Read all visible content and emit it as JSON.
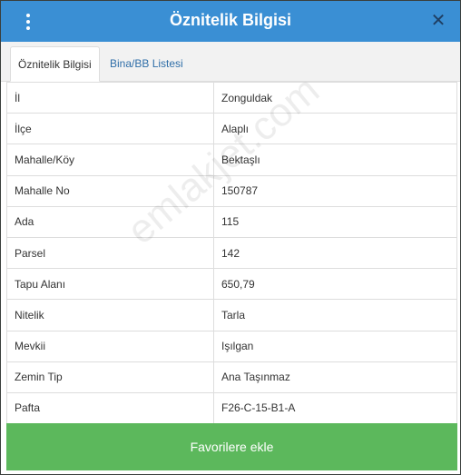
{
  "header": {
    "title": "Öznitelik Bilgisi",
    "menu_icon": "vertical-dots-icon",
    "close_icon": "close-icon",
    "close_glyph": "✕",
    "color": "#3a8fd4"
  },
  "tabs": [
    {
      "label": "Öznitelik Bilgisi",
      "active": true
    },
    {
      "label": "Bina/BB Listesi",
      "active": false
    }
  ],
  "attributes": [
    {
      "key": "İl",
      "value": "Zonguldak"
    },
    {
      "key": "İlçe",
      "value": "Alaplı"
    },
    {
      "key": "Mahalle/Köy",
      "value": "Bektaşlı"
    },
    {
      "key": "Mahalle No",
      "value": "150787"
    },
    {
      "key": "Ada",
      "value": "115"
    },
    {
      "key": "Parsel",
      "value": "142"
    },
    {
      "key": "Tapu Alanı",
      "value": "650,79"
    },
    {
      "key": "Nitelik",
      "value": "Tarla"
    },
    {
      "key": "Mevkii",
      "value": "Işılgan"
    },
    {
      "key": "Zemin Tip",
      "value": "Ana Taşınmaz"
    },
    {
      "key": "Pafta",
      "value": "F26-C-15-B1-A"
    }
  ],
  "watermark": "emlakjet.com",
  "footer": {
    "favorite_label": "Favorilere ekle",
    "color": "#5cb85c"
  }
}
